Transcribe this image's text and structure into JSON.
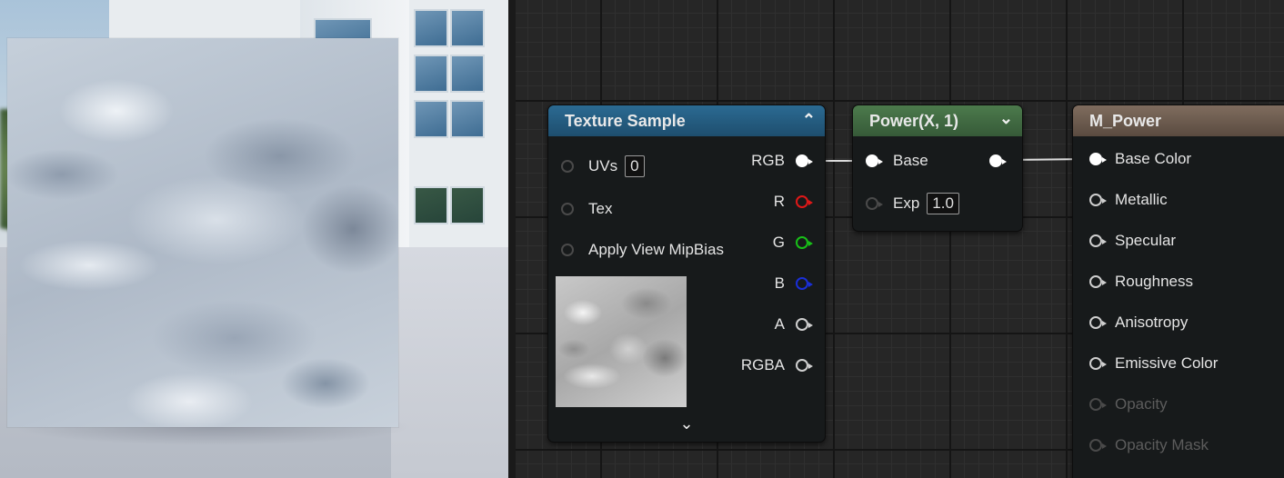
{
  "nodes": {
    "texture_sample": {
      "title": "Texture Sample",
      "inputs": [
        {
          "label": "UVs",
          "value": "0"
        },
        {
          "label": "Tex"
        },
        {
          "label": "Apply View MipBias"
        }
      ],
      "outputs": [
        {
          "label": "RGB",
          "color": "#ffffff"
        },
        {
          "label": "R",
          "color": "#e01818"
        },
        {
          "label": "G",
          "color": "#18c018"
        },
        {
          "label": "B",
          "color": "#1a2fd8"
        },
        {
          "label": "A",
          "color": "#cfcfcf"
        },
        {
          "label": "RGBA",
          "color": "#cfcfcf"
        }
      ]
    },
    "power": {
      "title": "Power(X, 1)",
      "inputs": [
        {
          "label": "Base"
        },
        {
          "label": "Exp",
          "value": "1.0"
        }
      ]
    },
    "material": {
      "title": "M_Power",
      "inputs": [
        {
          "label": "Base Color"
        },
        {
          "label": "Metallic"
        },
        {
          "label": "Specular"
        },
        {
          "label": "Roughness"
        },
        {
          "label": "Anisotropy"
        },
        {
          "label": "Emissive Color"
        },
        {
          "label": "Opacity"
        },
        {
          "label": "Opacity Mask"
        }
      ]
    }
  },
  "icons": {
    "collapse": "chevron-up-icon",
    "collapse_down": "chevron-down-icon",
    "expand": "chevron-down-icon"
  },
  "colors": {
    "texture_header": "#2b6a92",
    "power_header": "#4c7a4c",
    "material_header": "#7f6c5e"
  }
}
